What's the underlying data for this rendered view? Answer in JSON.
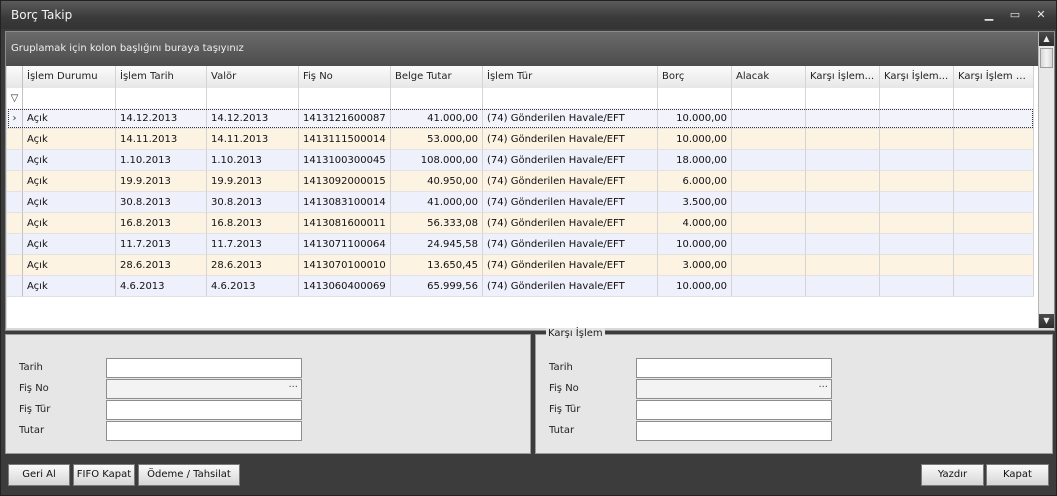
{
  "window": {
    "title": "Borç Takip"
  },
  "group_hint": "Gruplamak için kolon başlığını buraya taşıyınız",
  "columns": [
    "İşlem Durumu",
    "İşlem Tarih",
    "Valör",
    "Fiş No",
    "Belge Tutar",
    "İşlem Tür",
    "Borç",
    "Alacak",
    "Karşı İşlem...",
    "Karşı İşlem...",
    "Karşı İşlem F..."
  ],
  "rows": [
    {
      "durum": "Açık",
      "tarih": "14.12.2013",
      "valor": "14.12.2013",
      "fis_no": "1413121600087",
      "belge_tutar": "41.000,00",
      "tur": "(74) Gönderilen Havale/EFT",
      "borc": "10.000,00"
    },
    {
      "durum": "Açık",
      "tarih": "14.11.2013",
      "valor": "14.11.2013",
      "fis_no": "1413111500014",
      "belge_tutar": "53.000,00",
      "tur": "(74) Gönderilen Havale/EFT",
      "borc": "10.000,00"
    },
    {
      "durum": "Açık",
      "tarih": "1.10.2013",
      "valor": "1.10.2013",
      "fis_no": "1413100300045",
      "belge_tutar": "108.000,00",
      "tur": "(74) Gönderilen Havale/EFT",
      "borc": "18.000,00"
    },
    {
      "durum": "Açık",
      "tarih": "19.9.2013",
      "valor": "19.9.2013",
      "fis_no": "1413092000015",
      "belge_tutar": "40.950,00",
      "tur": "(74) Gönderilen Havale/EFT",
      "borc": "6.000,00"
    },
    {
      "durum": "Açık",
      "tarih": "30.8.2013",
      "valor": "30.8.2013",
      "fis_no": "1413083100014",
      "belge_tutar": "41.000,00",
      "tur": "(74) Gönderilen Havale/EFT",
      "borc": "3.500,00"
    },
    {
      "durum": "Açık",
      "tarih": "16.8.2013",
      "valor": "16.8.2013",
      "fis_no": "1413081600011",
      "belge_tutar": "56.333,08",
      "tur": "(74) Gönderilen Havale/EFT",
      "borc": "4.000,00"
    },
    {
      "durum": "Açık",
      "tarih": "11.7.2013",
      "valor": "11.7.2013",
      "fis_no": "1413071100064",
      "belge_tutar": "24.945,58",
      "tur": "(74) Gönderilen Havale/EFT",
      "borc": "10.000,00"
    },
    {
      "durum": "Açık",
      "tarih": "28.6.2013",
      "valor": "28.6.2013",
      "fis_no": "1413070100010",
      "belge_tutar": "13.650,45",
      "tur": "(74) Gönderilen Havale/EFT",
      "borc": "3.000,00"
    },
    {
      "durum": "Açık",
      "tarih": "4.6.2013",
      "valor": "4.6.2013",
      "fis_no": "1413060400069",
      "belge_tutar": "65.999,56",
      "tur": "(74) Gönderilen Havale/EFT",
      "borc": "10.000,00"
    }
  ],
  "left_form": {
    "labels": [
      "Tarih",
      "Fiş No",
      "Fiş Tür",
      "Tutar"
    ]
  },
  "right_form": {
    "title": "Karşı İşlem",
    "labels": [
      "Tarih",
      "Fiş No",
      "Fiş Tür",
      "Tutar"
    ]
  },
  "buttons": {
    "geri_al": "Geri Al",
    "fifo_kapat": "FIFO Kapat",
    "odeme_tahsilat": "Ödeme / Tahsilat",
    "yazdir": "Yazdır",
    "kapat": "Kapat"
  }
}
